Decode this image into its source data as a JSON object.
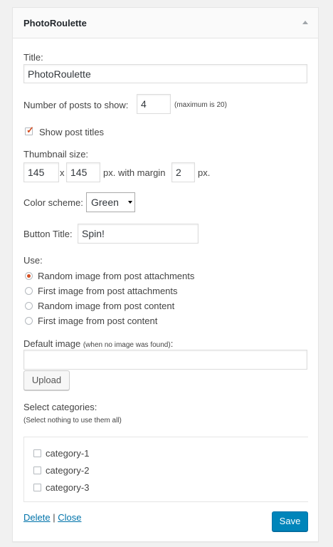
{
  "widget": {
    "title": "PhotoRoulette"
  },
  "form": {
    "title_label": "Title:",
    "title_value": "PhotoRoulette",
    "num_posts_label": "Number of posts to show:",
    "num_posts_value": "4",
    "num_posts_hint": "(maximum is 20)",
    "show_titles_label": "Show post titles",
    "show_titles_checked": true,
    "thumb_label": "Thumbnail size:",
    "thumb_width": "145",
    "thumb_x": "x",
    "thumb_height": "145",
    "margin_label": "px. with margin",
    "margin_value": "2",
    "margin_unit": "px.",
    "color_label": "Color scheme:",
    "color_value": "Green",
    "button_title_label": "Button Title:",
    "button_title_value": "Spin!",
    "use_label": "Use:",
    "use_options": [
      {
        "label": "Random image from post attachments",
        "selected": true
      },
      {
        "label": "First image from post attachments",
        "selected": false
      },
      {
        "label": "Random image from post content",
        "selected": false
      },
      {
        "label": "First image from post content",
        "selected": false
      }
    ],
    "default_image_label": "Default image",
    "default_image_hint": "(when no image was found)",
    "default_image_colon": ":",
    "default_image_value": "",
    "upload_label": "Upload",
    "categories_label": "Select categories:",
    "categories_hint": "(Select nothing to use them all)",
    "categories": [
      {
        "label": "category-1",
        "checked": false
      },
      {
        "label": "category-2",
        "checked": false
      },
      {
        "label": "category-3",
        "checked": false
      }
    ]
  },
  "actions": {
    "delete_label": "Delete",
    "separator": "|",
    "close_label": "Close",
    "save_label": "Save"
  },
  "colors": {
    "accent": "#d54e21",
    "primary": "#0085ba",
    "link": "#0073aa"
  }
}
